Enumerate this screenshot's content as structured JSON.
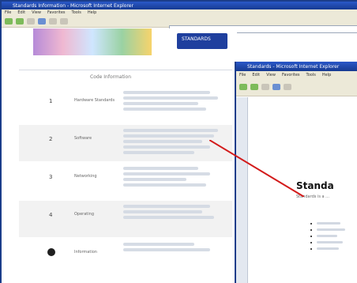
{
  "back_window": {
    "title_text": "Standards Information - Microsoft Internet Explorer",
    "menu": [
      "File",
      "Edit",
      "View",
      "Favorites",
      "Tools",
      "Help"
    ],
    "page_title": "Code Information",
    "rows": [
      {
        "number": "1",
        "label": "Hardware Standards"
      },
      {
        "number": "2",
        "label": "Software"
      },
      {
        "number": "3",
        "label": "Networking"
      },
      {
        "number": "4",
        "label": "Operating"
      },
      {
        "number": "",
        "label": "Information"
      }
    ],
    "logo_text": "STANDARDS"
  },
  "front_window": {
    "title_text": "Standards - Microsoft Internet Explorer",
    "menu": [
      "File",
      "Edit",
      "View",
      "Favorites",
      "Tools",
      "Help"
    ],
    "heading": "Standa",
    "subtext": "Standards is a ..."
  },
  "callout": {
    "color": "#d31b1b"
  }
}
